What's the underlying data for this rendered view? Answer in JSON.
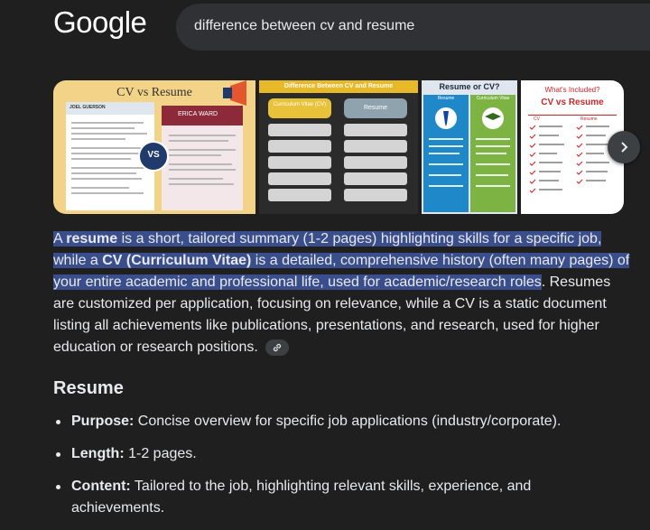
{
  "logo": "Google",
  "search": {
    "query": "difference between cv and resume"
  },
  "thumbnails": {
    "t1": {
      "title": "CV vs Resume",
      "badge": "VS",
      "doc_left": "JOEL GUERSON",
      "doc_right": "ERICA WARD"
    },
    "t2": {
      "banner": "Difference Between CV and Resume",
      "col1": "Curriculum Vitae (CV)",
      "col2": "Resume"
    },
    "t3": {
      "title": "Resume or CV?",
      "col1": "Resume",
      "col2": "Curriculum Vitae"
    },
    "t4": {
      "kicker": "What's Included?",
      "title": "CV vs Resume",
      "col1": "CV",
      "col2": "Resume"
    }
  },
  "answer": {
    "s1_a": "A ",
    "s1_b": "resume",
    "s1_c": " is a short, tailored summary (1-2 pages) highlighting skills for a specific job, while a ",
    "s1_d": "CV (Curriculum Vitae)",
    "s1_e": " is a detailed, comprehensive history (often many pages) of your entire academic and professional life, used for academic/research roles",
    "s1_end": ".",
    "s2": " Resumes are customized per application, focusing on relevance, while a CV is a static document listing all achievements like publications, presentations, and research, used for higher education or research positions."
  },
  "section": {
    "heading": "Resume",
    "items": [
      {
        "label": "Purpose:",
        "text": " Concise overview for specific job applications (industry/corporate)."
      },
      {
        "label": "Length:",
        "text": " 1-2 pages."
      },
      {
        "label": "Content:",
        "text": " Tailored to the job, highlighting relevant skills, experience, and achievements."
      }
    ]
  },
  "icons": {
    "next": "chevron-right-icon",
    "link": "link-icon"
  }
}
